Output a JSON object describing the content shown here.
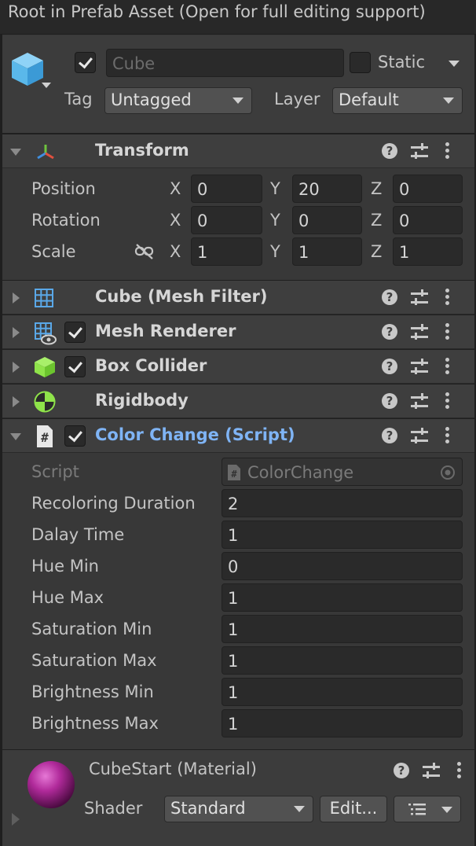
{
  "banner": {
    "text": "Root in Prefab Asset (Open for full editing support)"
  },
  "gameobject": {
    "active": true,
    "name_placeholder": "Cube",
    "static_label": "Static",
    "static_checked": false,
    "tag_label": "Tag",
    "tag_value": "Untagged",
    "layer_label": "Layer",
    "layer_value": "Default"
  },
  "components": {
    "transform": {
      "title": "Transform",
      "expanded": true,
      "rows": [
        {
          "label": "Position",
          "x": "0",
          "y": "20",
          "z": "0"
        },
        {
          "label": "Rotation",
          "x": "0",
          "y": "0",
          "z": "0"
        },
        {
          "label": "Scale",
          "x": "1",
          "y": "1",
          "z": "1"
        }
      ],
      "axis": {
        "x": "X",
        "y": "Y",
        "z": "Z"
      }
    },
    "mesh_filter": {
      "title": "Cube (Mesh Filter)"
    },
    "mesh_renderer": {
      "title": "Mesh Renderer",
      "enabled": true
    },
    "box_collider": {
      "title": "Box Collider",
      "enabled": true
    },
    "rigidbody": {
      "title": "Rigidbody"
    },
    "color_change": {
      "title": "Color Change (Script)",
      "enabled": true,
      "script_label": "Script",
      "script_value": "ColorChange",
      "fields": [
        {
          "label": "Recoloring Duration",
          "value": "2"
        },
        {
          "label": "Dalay Time",
          "value": "1"
        },
        {
          "label": "Hue Min",
          "value": "0"
        },
        {
          "label": "Hue Max",
          "value": "1"
        },
        {
          "label": "Saturation Min",
          "value": "1"
        },
        {
          "label": "Saturation Max",
          "value": "1"
        },
        {
          "label": "Brightness Min",
          "value": "1"
        },
        {
          "label": "Brightness Max",
          "value": "1"
        }
      ]
    }
  },
  "material": {
    "name": "CubeStart",
    "type_suffix": "(Material)",
    "shader_label": "Shader",
    "shader_value": "Standard",
    "edit_label": "Edit...",
    "color": "#b02a9a"
  },
  "colors": {
    "script_title": "#7fb4f5",
    "collider_icon": "#8fe34a",
    "rigidbody_icon": "#8fe34a",
    "grid_icon": "#5aa8e8",
    "cube_icon": "#5ab8ea"
  }
}
